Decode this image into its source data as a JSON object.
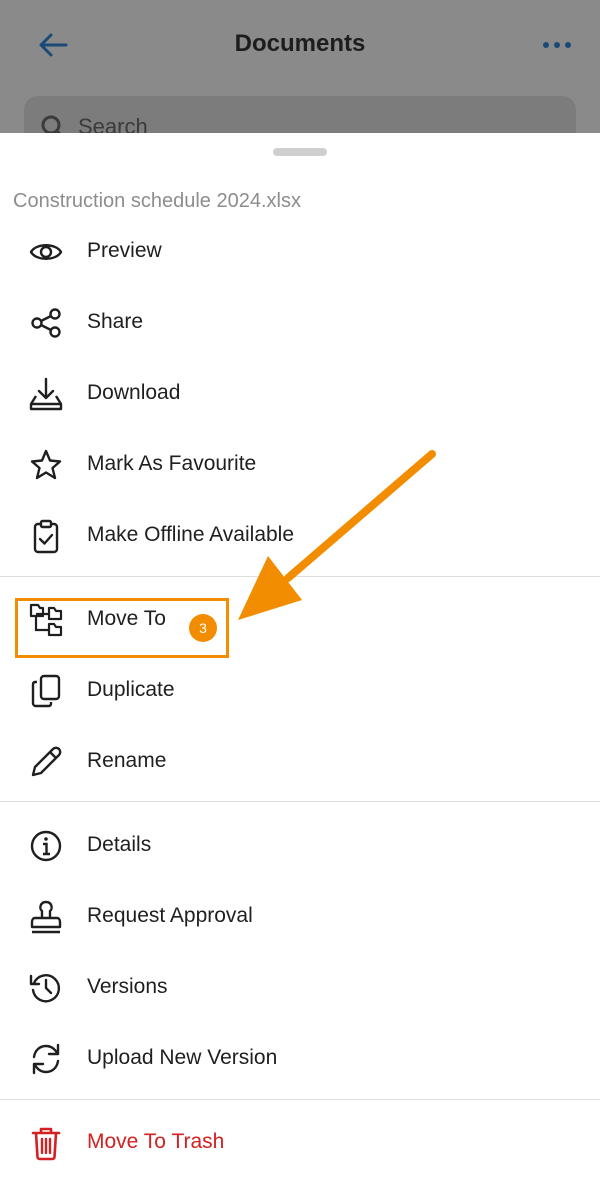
{
  "background": {
    "title": "Documents",
    "search_placeholder": "Search"
  },
  "sheet": {
    "file_name": "Construction schedule 2024.xlsx",
    "items": [
      {
        "label": "Preview",
        "icon": "eye-icon"
      },
      {
        "label": "Share",
        "icon": "share-icon"
      },
      {
        "label": "Download",
        "icon": "download-icon"
      },
      {
        "label": "Mark As Favourite",
        "icon": "star-icon"
      },
      {
        "label": "Make Offline Available",
        "icon": "clipboard-check-icon"
      },
      {
        "label": "Move To",
        "icon": "folder-tree-icon"
      },
      {
        "label": "Duplicate",
        "icon": "duplicate-icon"
      },
      {
        "label": "Rename",
        "icon": "pencil-icon"
      },
      {
        "label": "Details",
        "icon": "info-icon"
      },
      {
        "label": "Request Approval",
        "icon": "stamp-icon"
      },
      {
        "label": "Versions",
        "icon": "history-icon"
      },
      {
        "label": "Upload New Version",
        "icon": "refresh-icon"
      },
      {
        "label": "Move To Trash",
        "icon": "trash-icon"
      }
    ]
  },
  "annotation": {
    "step_number": "3",
    "accent_color": "#f28c00"
  },
  "colors": {
    "danger": "#d32020",
    "accent": "#1a5fa8"
  }
}
